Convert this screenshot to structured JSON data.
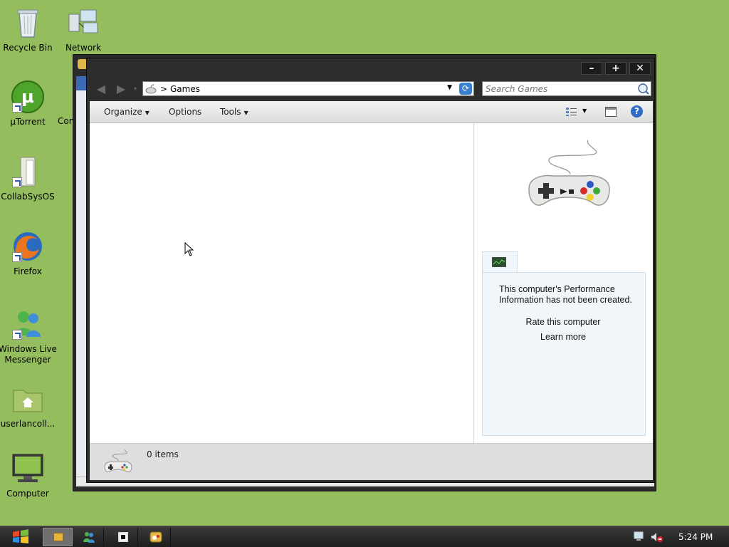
{
  "desktop": {
    "icons": [
      {
        "label": "Recycle Bin"
      },
      {
        "label": "Network"
      },
      {
        "label": "µTorrent"
      },
      {
        "label": "Con"
      },
      {
        "label": "CollabSysOS"
      },
      {
        "label": "Firefox"
      },
      {
        "label": "Windows Live Messenger"
      },
      {
        "label": "userlancoll..."
      },
      {
        "label": "Computer"
      }
    ]
  },
  "window": {
    "controls": {
      "minimize": "–",
      "maximize": "+",
      "close": "✕"
    },
    "address": {
      "breadcrumb_sep": ">",
      "location": "Games"
    },
    "search": {
      "placeholder": "Search Games"
    },
    "toolbar": {
      "organize": "Organize",
      "options": "Options",
      "tools": "Tools"
    },
    "details": {
      "perf_message": "This computer's Performance Information has not been created.",
      "rate_link": "Rate this computer",
      "learn_link": "Learn more"
    },
    "status": {
      "item_count": "0 items"
    }
  },
  "taskbar": {
    "clock": "5:24 PM"
  },
  "colors": {
    "desktop": "#94bd5e",
    "window_frame": "#2d2d2d",
    "accent": "#3a7fd0"
  }
}
